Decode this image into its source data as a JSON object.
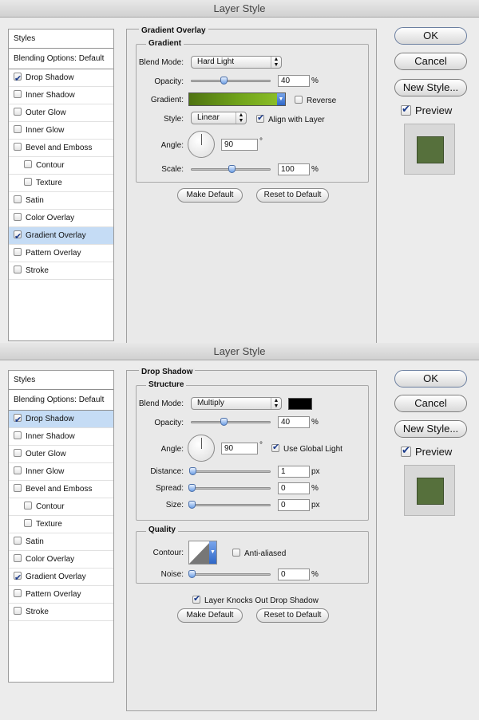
{
  "top": {
    "title": "Layer Style",
    "styles_header": "Styles",
    "blending_options": "Blending Options: Default",
    "items": [
      {
        "label": "Drop Shadow",
        "checked": true
      },
      {
        "label": "Inner Shadow",
        "checked": false
      },
      {
        "label": "Outer Glow",
        "checked": false
      },
      {
        "label": "Inner Glow",
        "checked": false
      },
      {
        "label": "Bevel and Emboss",
        "checked": false
      },
      {
        "label": "Contour",
        "checked": false
      },
      {
        "label": "Texture",
        "checked": false
      },
      {
        "label": "Satin",
        "checked": false
      },
      {
        "label": "Color Overlay",
        "checked": false
      },
      {
        "label": "Gradient Overlay",
        "checked": true,
        "selected": true
      },
      {
        "label": "Pattern Overlay",
        "checked": false
      },
      {
        "label": "Stroke",
        "checked": false
      }
    ],
    "panel_title": "Gradient Overlay",
    "section_title": "Gradient",
    "blend_mode_label": "Blend Mode:",
    "blend_mode_value": "Hard Light",
    "opacity_label": "Opacity:",
    "opacity_value": "40",
    "opacity_fraction": 0.4,
    "percent": "%",
    "gradient_label": "Gradient:",
    "gradient_colors": [
      "#4f7311",
      "#6fa21a",
      "#8fc22a"
    ],
    "reverse_label": "Reverse",
    "style_label": "Style:",
    "style_value": "Linear",
    "align_label": "Align with Layer",
    "angle_label": "Angle:",
    "angle_value": "90",
    "degree": "°",
    "scale_label": "Scale:",
    "scale_value": "100",
    "scale_fraction": 0.5,
    "make_default": "Make Default",
    "reset_default": "Reset to Default",
    "ok": "OK",
    "cancel": "Cancel",
    "new_style": "New Style...",
    "preview": "Preview",
    "preview_color": "#56703c"
  },
  "bottom": {
    "title": "Layer Style",
    "styles_header": "Styles",
    "blending_options": "Blending Options: Default",
    "items": [
      {
        "label": "Drop Shadow",
        "checked": true,
        "selected": true
      },
      {
        "label": "Inner Shadow",
        "checked": false
      },
      {
        "label": "Outer Glow",
        "checked": false
      },
      {
        "label": "Inner Glow",
        "checked": false
      },
      {
        "label": "Bevel and Emboss",
        "checked": false
      },
      {
        "label": "Contour",
        "checked": false
      },
      {
        "label": "Texture",
        "checked": false
      },
      {
        "label": "Satin",
        "checked": false
      },
      {
        "label": "Color Overlay",
        "checked": false
      },
      {
        "label": "Gradient Overlay",
        "checked": true
      },
      {
        "label": "Pattern Overlay",
        "checked": false
      },
      {
        "label": "Stroke",
        "checked": false
      }
    ],
    "panel_title": "Drop Shadow",
    "section_title": "Structure",
    "blend_mode_label": "Blend Mode:",
    "blend_mode_value": "Multiply",
    "shadow_color": "#000000",
    "opacity_label": "Opacity:",
    "opacity_value": "40",
    "opacity_fraction": 0.4,
    "percent": "%",
    "angle_label": "Angle:",
    "angle_value": "90",
    "degree": "°",
    "global_light_label": "Use Global Light",
    "distance_label": "Distance:",
    "distance_value": "1",
    "px": "px",
    "spread_label": "Spread:",
    "spread_value": "0",
    "size_label": "Size:",
    "size_value": "0",
    "quality_title": "Quality",
    "contour_label": "Contour:",
    "antialiased_label": "Anti-aliased",
    "noise_label": "Noise:",
    "noise_value": "0",
    "knockout_label": "Layer Knocks Out Drop Shadow",
    "make_default": "Make Default",
    "reset_default": "Reset to Default",
    "ok": "OK",
    "cancel": "Cancel",
    "new_style": "New Style...",
    "preview": "Preview",
    "preview_color": "#56703c"
  }
}
